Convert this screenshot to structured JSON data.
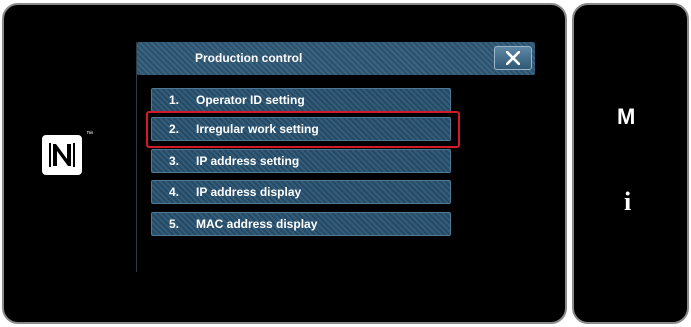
{
  "dialog": {
    "title": "Production control",
    "close_label": "✕"
  },
  "menu": {
    "items": [
      {
        "number": "1.",
        "label": "Operator ID setting"
      },
      {
        "number": "2.",
        "label": "Irregular work setting"
      },
      {
        "number": "3.",
        "label": "IP address setting"
      },
      {
        "number": "4.",
        "label": "IP address display"
      },
      {
        "number": "5.",
        "label": "MAC address display"
      }
    ],
    "highlighted_index": 1
  },
  "side_panel": {
    "mode_label": "M",
    "info_label": "i"
  },
  "nfc": {
    "trademark": "™",
    "icon": "nfc-icon"
  },
  "colors": {
    "highlight": "#d11a2a",
    "background": "#000000",
    "button_blue": "#2c516c"
  }
}
